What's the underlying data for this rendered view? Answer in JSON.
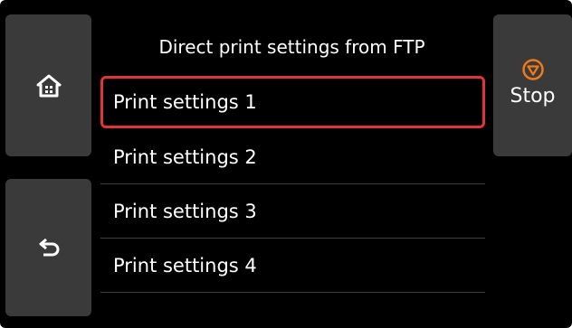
{
  "header": {
    "title": "Direct print settings from FTP"
  },
  "list": {
    "items": [
      {
        "label": "Print settings 1"
      },
      {
        "label": "Print settings 2"
      },
      {
        "label": "Print settings 3"
      },
      {
        "label": "Print settings 4"
      }
    ],
    "selected_index": 0
  },
  "buttons": {
    "home_icon": "home-icon",
    "back_icon": "back-arrow-icon",
    "stop_icon": "stop-icon",
    "stop_label": "Stop"
  },
  "colors": {
    "background": "#000000",
    "button_bg": "#3a3a3a",
    "selection_border": "#e0333a",
    "stop_icon": "#f07a1a",
    "text": "#ffffff"
  }
}
